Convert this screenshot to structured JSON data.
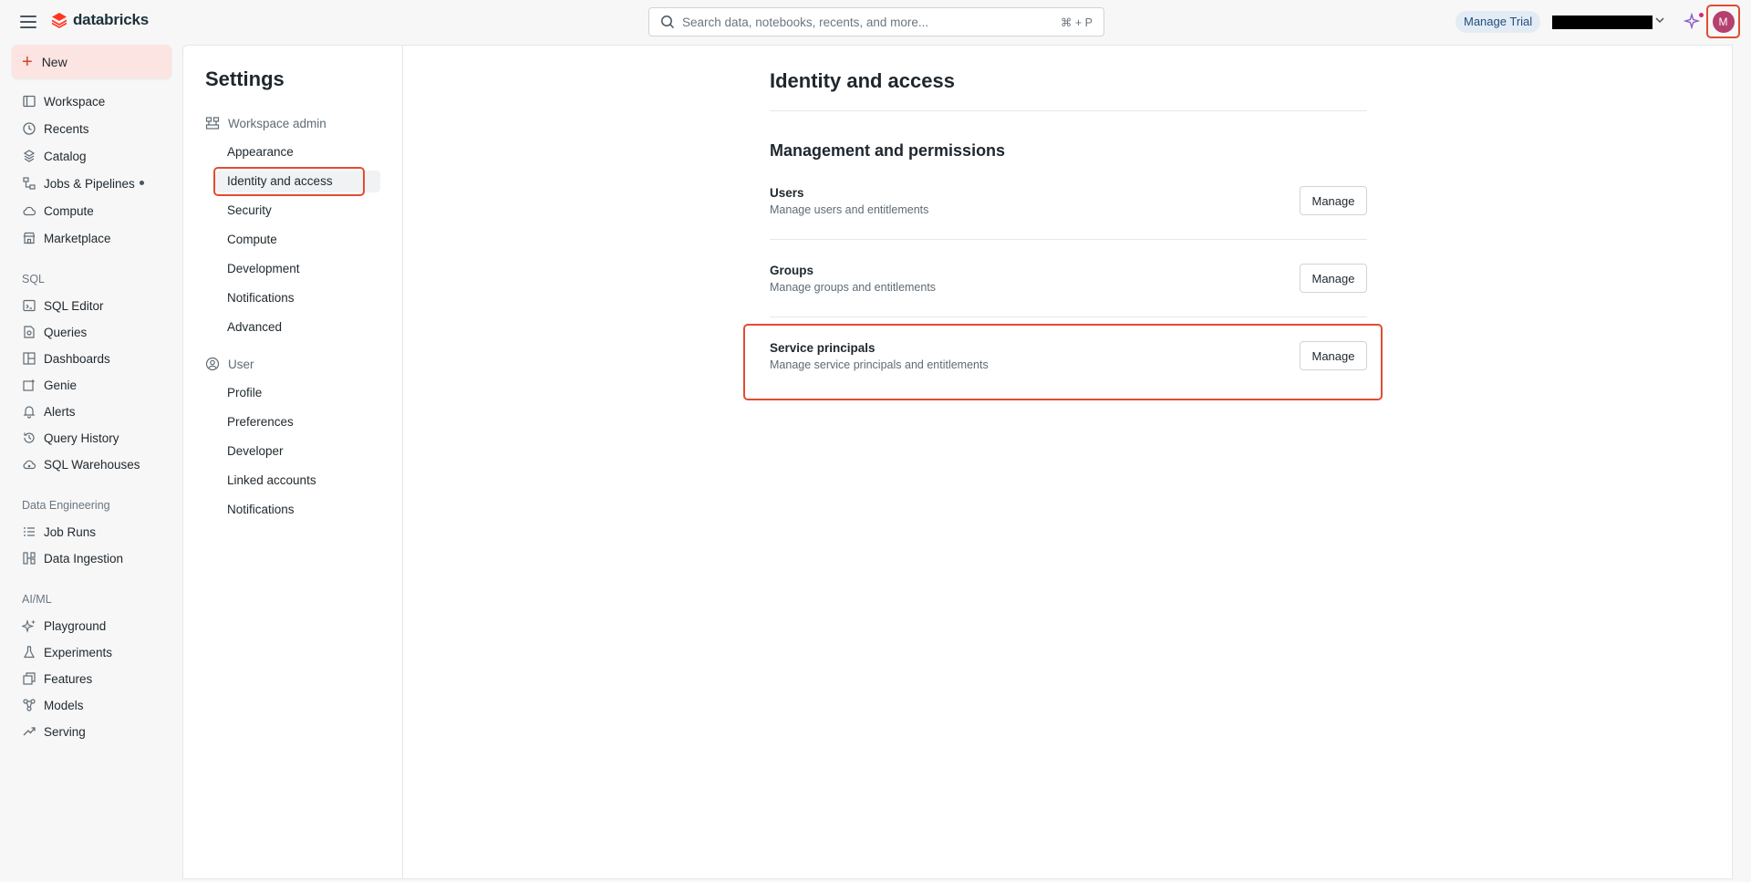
{
  "topbar": {
    "brand": "databricks",
    "search_placeholder": "Search data, notebooks, recents, and more...",
    "search_shortcut": "⌘ + P",
    "manage_trial": "Manage Trial",
    "avatar_initial": "M"
  },
  "sidebar": {
    "new_label": "New",
    "main_items": [
      {
        "label": "Workspace",
        "icon": "folder-icon"
      },
      {
        "label": "Recents",
        "icon": "clock-icon"
      },
      {
        "label": "Catalog",
        "icon": "catalog-icon"
      },
      {
        "label": "Jobs & Pipelines",
        "icon": "workflow-icon"
      },
      {
        "label": "Compute",
        "icon": "cloud-icon"
      },
      {
        "label": "Marketplace",
        "icon": "store-icon"
      }
    ],
    "sql_section": "SQL",
    "sql_items": [
      {
        "label": "SQL Editor",
        "icon": "sql-editor-icon"
      },
      {
        "label": "Queries",
        "icon": "query-icon"
      },
      {
        "label": "Dashboards",
        "icon": "dashboard-icon"
      },
      {
        "label": "Genie",
        "icon": "genie-icon"
      },
      {
        "label": "Alerts",
        "icon": "bell-icon"
      },
      {
        "label": "Query History",
        "icon": "history-icon"
      },
      {
        "label": "SQL Warehouses",
        "icon": "warehouse-icon"
      }
    ],
    "de_section": "Data Engineering",
    "de_items": [
      {
        "label": "Job Runs",
        "icon": "list-icon"
      },
      {
        "label": "Data Ingestion",
        "icon": "ingestion-icon"
      }
    ],
    "ml_section": "AI/ML",
    "ml_items": [
      {
        "label": "Playground",
        "icon": "sparkle-icon"
      },
      {
        "label": "Experiments",
        "icon": "flask-icon"
      },
      {
        "label": "Features",
        "icon": "features-icon"
      },
      {
        "label": "Models",
        "icon": "model-icon"
      },
      {
        "label": "Serving",
        "icon": "serving-icon"
      }
    ]
  },
  "settings": {
    "title": "Settings",
    "workspace_admin": "Workspace admin",
    "admin_items": [
      "Appearance",
      "Identity and access",
      "Security",
      "Compute",
      "Development",
      "Notifications",
      "Advanced"
    ],
    "user_section": "User",
    "user_items": [
      "Profile",
      "Preferences",
      "Developer",
      "Linked accounts",
      "Notifications"
    ]
  },
  "content": {
    "title": "Identity and access",
    "section": "Management and permissions",
    "rows": [
      {
        "title": "Users",
        "desc": "Manage users and entitlements",
        "button": "Manage"
      },
      {
        "title": "Groups",
        "desc": "Manage groups and entitlements",
        "button": "Manage"
      },
      {
        "title": "Service principals",
        "desc": "Manage service principals and entitlements",
        "button": "Manage"
      }
    ]
  },
  "colors": {
    "accent": "#e24c31",
    "brand": "#ff3621",
    "trial_bg": "#e3ecf5"
  }
}
